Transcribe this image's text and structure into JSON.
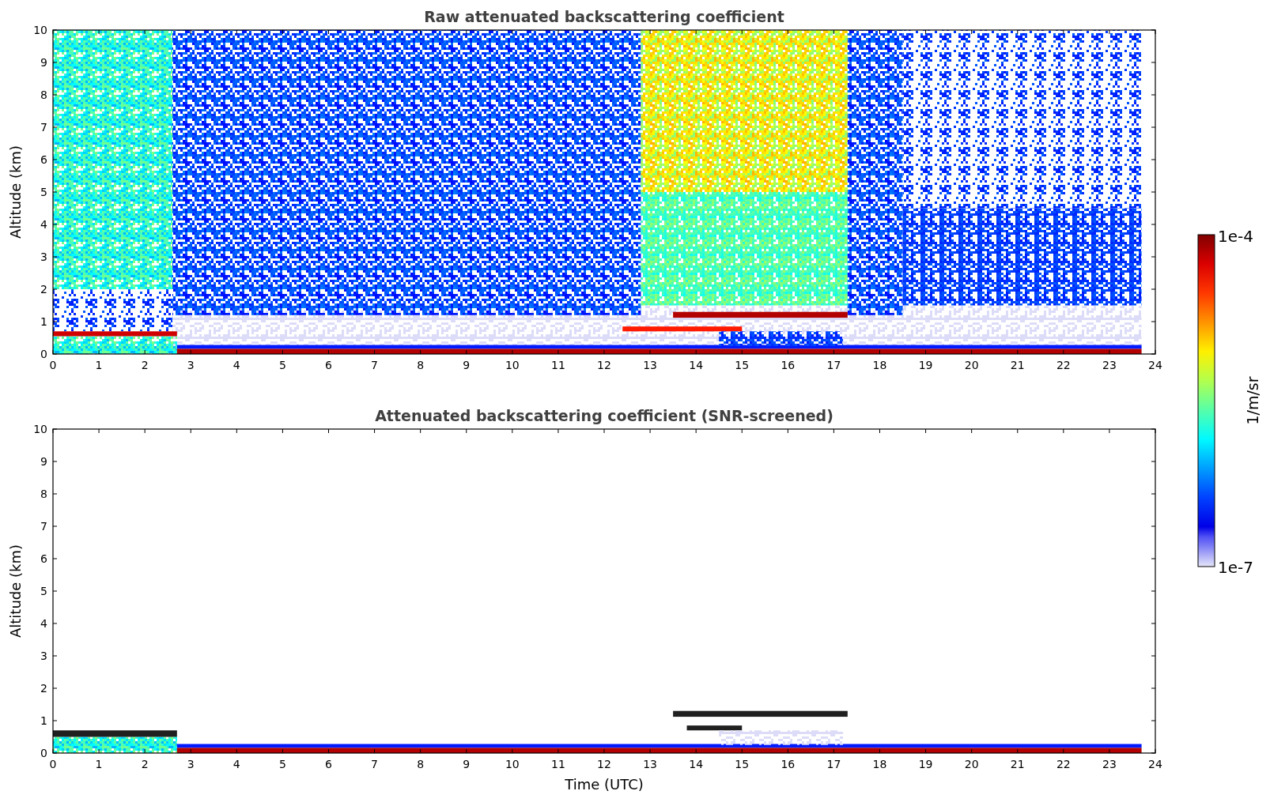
{
  "plots": [
    {
      "kind": "raw",
      "title": "Raw attenuated backscattering coefficient",
      "ylabel": "Altitude (km)",
      "xticks": [
        "0",
        "1",
        "2",
        "3",
        "4",
        "5",
        "6",
        "7",
        "8",
        "9",
        "10",
        "11",
        "12",
        "13",
        "14",
        "15",
        "16",
        "17",
        "18",
        "19",
        "20",
        "21",
        "22",
        "23",
        "24"
      ],
      "yticks": [
        "10",
        "9",
        "8",
        "7",
        "6",
        "5",
        "4",
        "3",
        "2",
        "1",
        "0"
      ]
    },
    {
      "kind": "screened",
      "title": "Attenuated backscattering coefficient (SNR-screened)",
      "ylabel": "Altitude (km)",
      "xlabel": "Time (UTC)",
      "xticks": [
        "0",
        "1",
        "2",
        "3",
        "4",
        "5",
        "6",
        "7",
        "8",
        "9",
        "10",
        "11",
        "12",
        "13",
        "14",
        "15",
        "16",
        "17",
        "18",
        "19",
        "20",
        "21",
        "22",
        "23",
        "24"
      ],
      "yticks": [
        "10",
        "9",
        "8",
        "7",
        "6",
        "5",
        "4",
        "3",
        "2",
        "1",
        "0"
      ]
    }
  ],
  "colorbar": {
    "max": "1e-4",
    "min": "1e-7",
    "label": "1/m/sr"
  }
}
